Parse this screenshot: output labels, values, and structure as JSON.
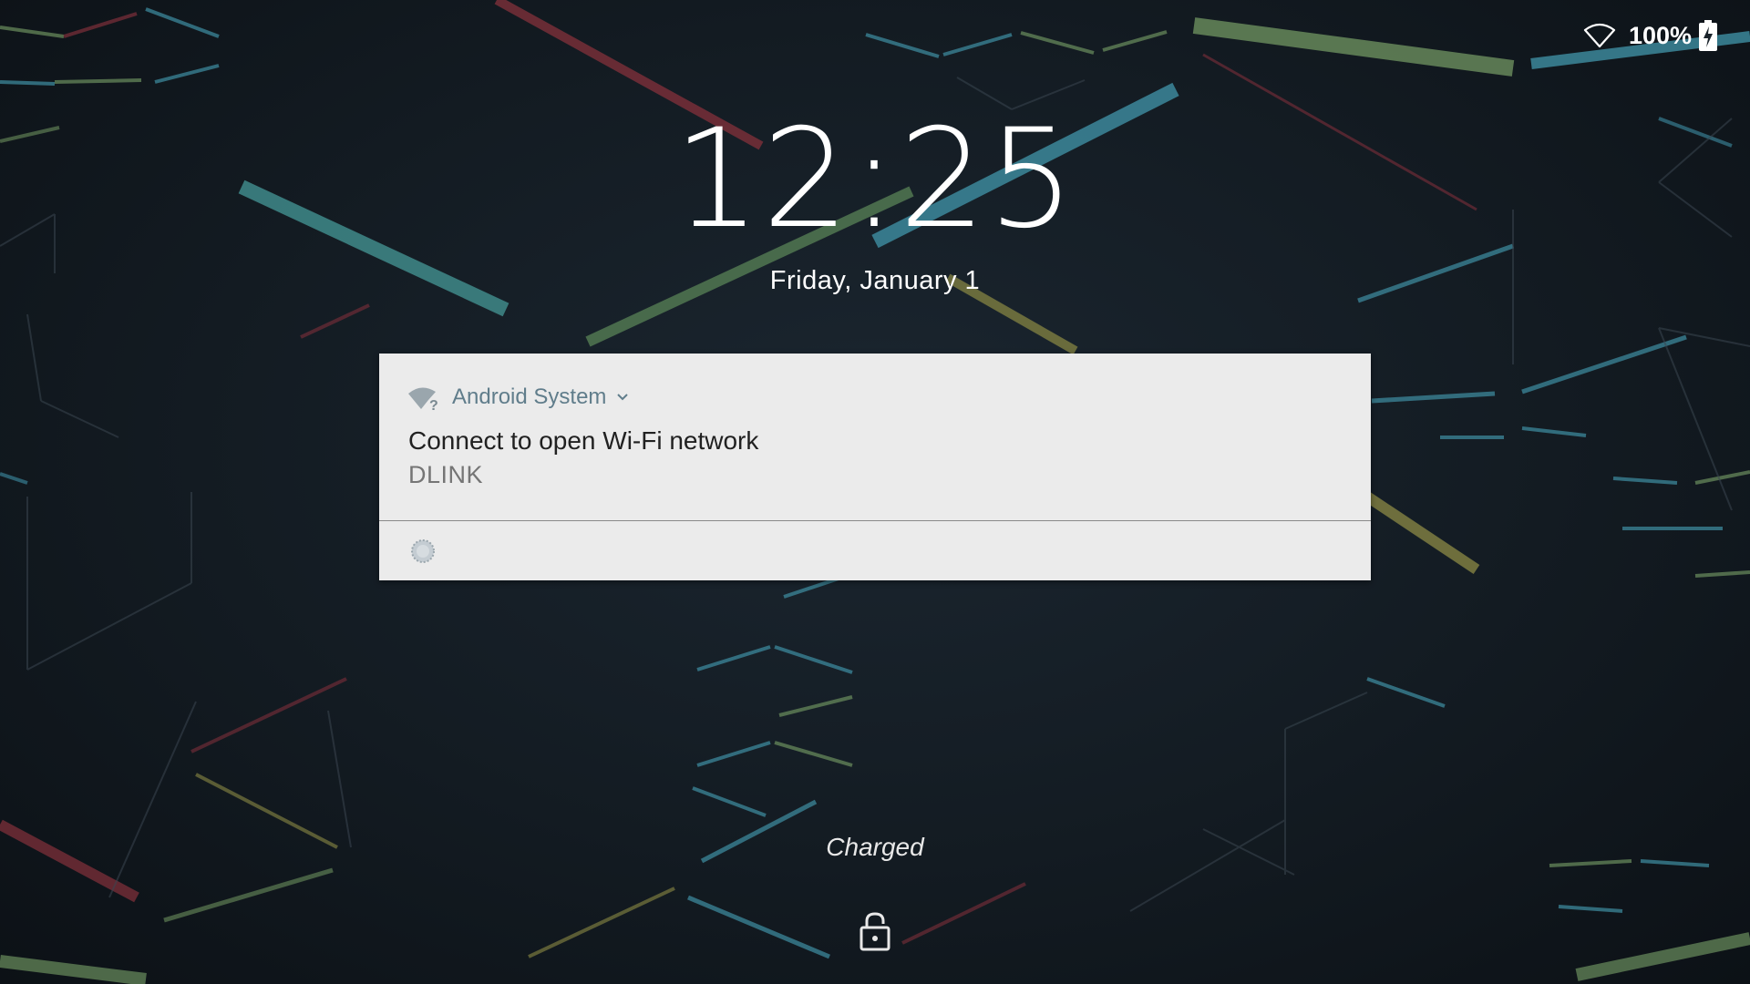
{
  "status_bar": {
    "wifi_icon": "wifi-empty-icon",
    "battery_percent": "100%",
    "battery_icon": "battery-charging-icon"
  },
  "lockscreen": {
    "time": "12:25",
    "date": "Friday, January 1",
    "charging_status": "Charged",
    "lock_icon": "lock-open-icon"
  },
  "notification": {
    "app_icon": "wifi-question-icon",
    "app_name": "Android System",
    "title": "Connect to open Wi-Fi network",
    "text": "DLINK",
    "action_icon": "spinner-icon"
  },
  "colors": {
    "notification_background": "#ebebeb",
    "app_name_color": "#607d8b",
    "title_color": "#212121",
    "text_color": "#757575"
  }
}
